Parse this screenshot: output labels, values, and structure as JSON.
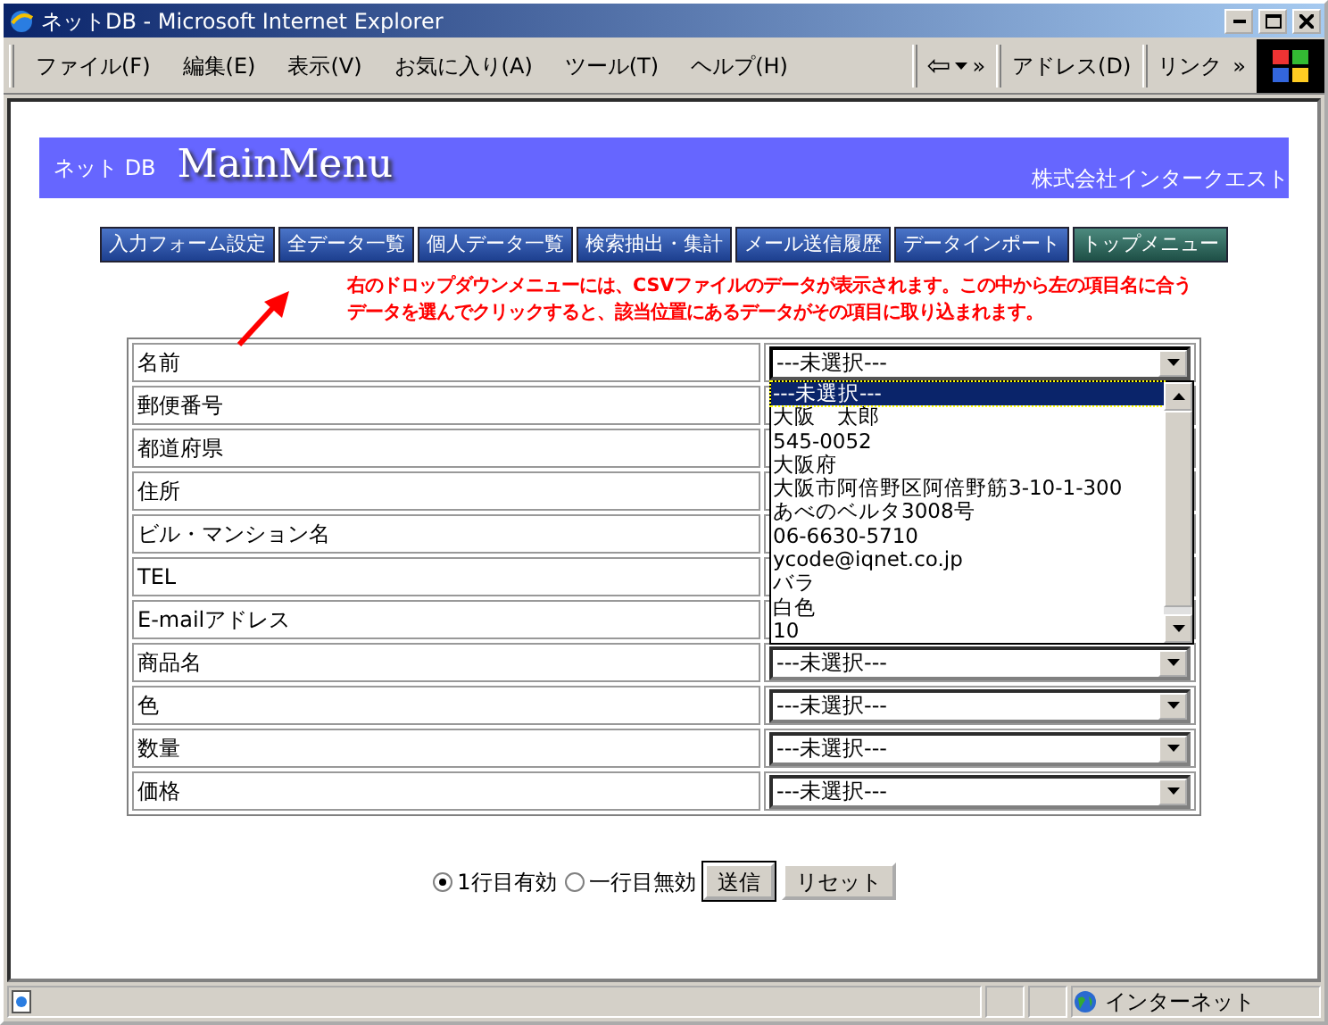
{
  "window": {
    "title": "ネットDB - Microsoft Internet Explorer"
  },
  "menu": [
    "ファイル(F)",
    "編集(E)",
    "表示(V)",
    "お気に入り(A)",
    "ツール(T)",
    "ヘルプ(H)"
  ],
  "toolbar": {
    "back": "⇦",
    "chevron": "»",
    "address": "アドレス(D)",
    "links": "リンク",
    "links_chevron": "»"
  },
  "banner": {
    "subtitle": "ネット DB",
    "title": "MainMenu",
    "company": "株式会社インタークエスト"
  },
  "nav": [
    {
      "label": "入力フォーム設定",
      "kind": "blue"
    },
    {
      "label": "全データ一覧",
      "kind": "blue"
    },
    {
      "label": "個人データ一覧",
      "kind": "blue"
    },
    {
      "label": "検索抽出・集計",
      "kind": "blue"
    },
    {
      "label": "メール送信履歴",
      "kind": "blue"
    },
    {
      "label": "データインポート",
      "kind": "blue"
    },
    {
      "label": "トップメニュー",
      "kind": "green"
    }
  ],
  "instruction": "右のドロップダウンメニューには、CSVファイルのデータが表示されます。この中から左の項目名に合うデータを選んでクリックすると、該当位置にあるデータがその項目に取り込まれます。",
  "fields": [
    {
      "label": "名前",
      "select": "---未選択---",
      "expanded": true
    },
    {
      "label": "郵便番号",
      "expanded": false
    },
    {
      "label": "都道府県",
      "expanded": false
    },
    {
      "label": "住所",
      "expanded": false
    },
    {
      "label": "ビル・マンション名",
      "expanded": false
    },
    {
      "label": "TEL",
      "expanded": false
    },
    {
      "label": "E-mailアドレス",
      "expanded": false
    },
    {
      "label": "商品名",
      "select": "---未選択---",
      "expanded": false
    },
    {
      "label": "色",
      "select": "---未選択---",
      "expanded": false
    },
    {
      "label": "数量",
      "select": "---未選択---",
      "expanded": false
    },
    {
      "label": "価格",
      "select": "---未選択---",
      "expanded": false
    }
  ],
  "dropdown_options": [
    {
      "label": "---未選択---",
      "selected": true
    },
    {
      "label": "大阪　太郎",
      "selected": false
    },
    {
      "label": "545-0052",
      "selected": false
    },
    {
      "label": "大阪府",
      "selected": false
    },
    {
      "label": "大阪市阿倍野区阿倍野筋3-10-1-300",
      "selected": false
    },
    {
      "label": "あべのベルタ3008号",
      "selected": false
    },
    {
      "label": "06-6630-5710",
      "selected": false
    },
    {
      "label": "ycode@iqnet.co.jp",
      "selected": false
    },
    {
      "label": "バラ",
      "selected": false
    },
    {
      "label": "白色",
      "selected": false
    },
    {
      "label": "10",
      "selected": false
    }
  ],
  "radios": [
    {
      "label": "1行目有効",
      "selected": true
    },
    {
      "label": "一行目無効",
      "selected": false
    }
  ],
  "buttons": [
    "送信",
    "リセット"
  ],
  "status_bar": {
    "zone": "インターネット"
  }
}
